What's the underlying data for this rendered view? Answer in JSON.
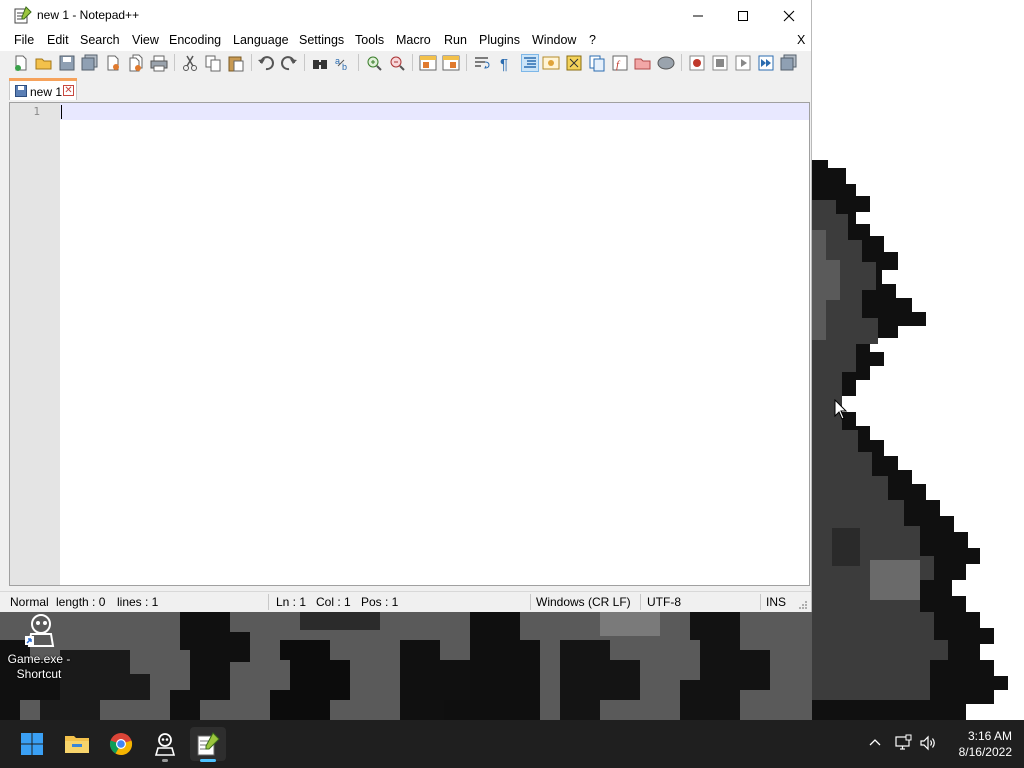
{
  "window": {
    "title": "new 1 - Notepad++",
    "controls": {
      "minimize": "minimize",
      "maximize": "maximize",
      "close": "close"
    }
  },
  "menu": {
    "items": [
      "File",
      "Edit",
      "Search",
      "View",
      "Encoding",
      "Language",
      "Settings",
      "Tools",
      "Macro",
      "Run",
      "Plugins",
      "Window",
      "?"
    ],
    "close_doc": "X"
  },
  "tabs": [
    {
      "label": "new 1",
      "active": true
    }
  ],
  "editor": {
    "line_numbers": [
      "1"
    ],
    "content": ""
  },
  "statusbar": {
    "mode": "Normal",
    "length": "length : 0",
    "lines": "lines : 1",
    "ln": "Ln : 1",
    "col": "Col : 1",
    "pos": "Pos : 1",
    "eol": "Windows (CR LF)",
    "encoding": "UTF-8",
    "ins": "INS"
  },
  "desktop": {
    "shortcut": {
      "line1": "Game.exe -",
      "line2": "Shortcut"
    }
  },
  "taskbar": {
    "apps": [
      "start-icon",
      "file-explorer-icon",
      "chrome-icon",
      "game-icon",
      "notepadpp-icon"
    ],
    "tray": [
      "chevron-up-icon",
      "network-icon",
      "volume-icon"
    ],
    "time": "3:16 AM",
    "date": "8/16/2022"
  },
  "colors": {
    "taskbar_bg": "#1f1f1f",
    "tab_accent": "#f6a25b",
    "current_line": "#e8e8ff",
    "gutter": "#e4e4e4"
  }
}
